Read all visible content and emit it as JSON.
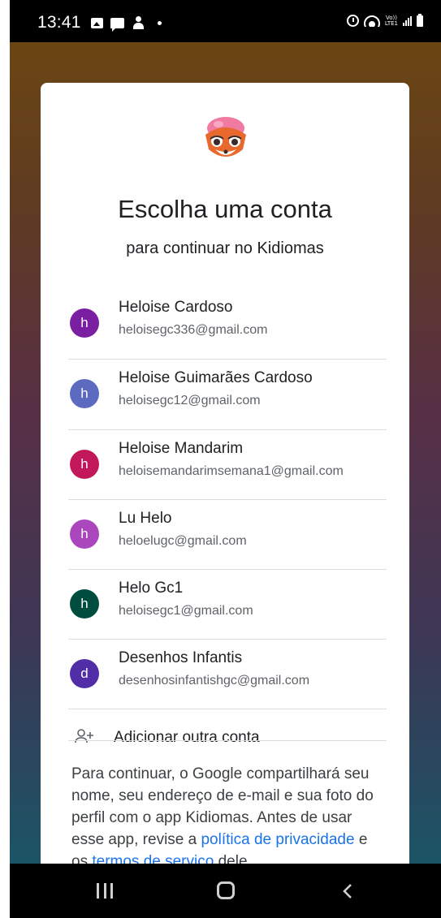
{
  "status_bar": {
    "time": "13:41",
    "volte_top": "Vo))",
    "volte_bottom": "LTE1"
  },
  "dialog": {
    "title": "Escolha uma conta",
    "subtitle": "para continuar no Kidiomas",
    "accounts": [
      {
        "initial": "h",
        "name": "Heloise Cardoso",
        "email": "heloisegc336@gmail.com",
        "color": "#7b1fa2"
      },
      {
        "initial": "h",
        "name": "Heloise Guimarães Cardoso",
        "email": "heloisegc12@gmail.com",
        "color": "#5c6bc0"
      },
      {
        "initial": "h",
        "name": "Heloise Mandarim",
        "email": "heloisemandarimsemana1@gmail.com",
        "color": "#c2185b"
      },
      {
        "initial": "h",
        "name": "Lu Helo",
        "email": "heloelugc@gmail.com",
        "color": "#ab47bc"
      },
      {
        "initial": "h",
        "name": "Helo Gc1",
        "email": "heloisegc1@gmail.com",
        "color": "#004d40"
      },
      {
        "initial": "d",
        "name": "Desenhos Infantis",
        "email": "desenhosinfantishgc@gmail.com",
        "color": "#512da8"
      }
    ],
    "add_account_label": "Adicionar outra conta",
    "disclaimer": {
      "text_1": "Para continuar, o Google compartilhará seu nome, seu endereço de e-mail e sua foto do perfil com o app Kidiomas. Antes de usar esse app, revise a ",
      "privacy_link": "política de privacidade",
      "text_2": " e os ",
      "terms_link": "termos de serviço",
      "text_3": " dele."
    }
  },
  "colors": {
    "link": "#1a73e8",
    "title_text": "#202124",
    "secondary_text": "#5f6368"
  },
  "icons": [
    "gallery-icon",
    "chat-icon",
    "person-icon",
    "alarm-icon",
    "wifi-icon",
    "signal-icon",
    "battery-icon",
    "add-person-icon",
    "recents-icon",
    "home-icon",
    "back-icon"
  ]
}
